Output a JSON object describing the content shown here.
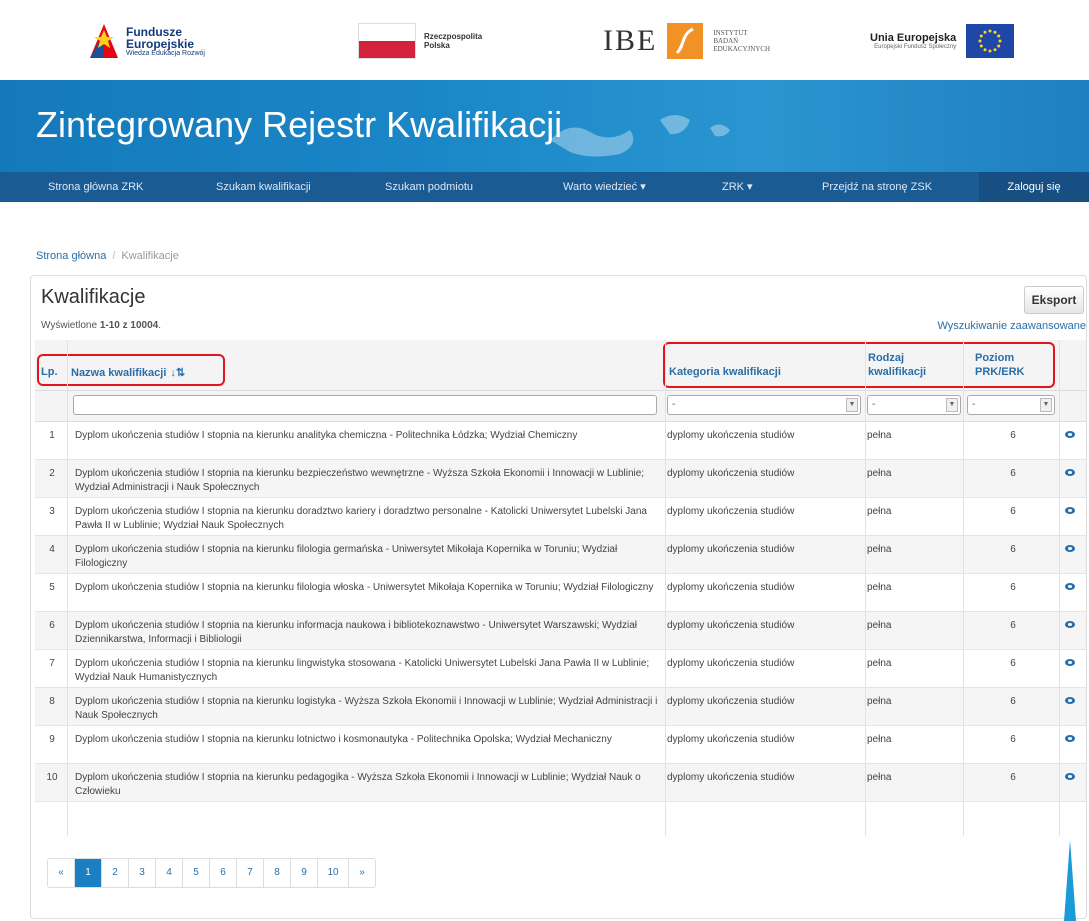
{
  "logos": {
    "fe": [
      "Fundusze",
      "Europejskie",
      "Wiedza Edukacja Rozwój"
    ],
    "rp": [
      "Rzeczpospolita",
      "Polska"
    ],
    "ibe": "IBE",
    "ibe_inst": [
      "INSTYTUT",
      "BADAŃ",
      "EDUKACYJNYCH"
    ],
    "ue": [
      "Unia Europejska",
      "Europejski Fundusz Społeczny"
    ]
  },
  "banner": {
    "title": "Zintegrowany Rejestr Kwalifikacji"
  },
  "nav": {
    "items": [
      "Strona główna ZRK",
      "Szukam kwalifikacji",
      "Szukam podmiotu",
      "Warto wiedzieć ▾",
      "ZRK ▾",
      "Przejdź na stronę ZSK"
    ],
    "login": "Zaloguj się"
  },
  "breadcrumb": {
    "home": "Strona główna",
    "separator": "/",
    "current": "Kwalifikacje"
  },
  "panel": {
    "title": "Kwalifikacje",
    "export": "Eksport",
    "count_prefix": "Wyświetlone ",
    "count_range": "1-10 z 10004",
    "count_suffix": ".",
    "advanced": "Wyszukiwanie zaawansowane"
  },
  "table": {
    "headers": {
      "lp": "Lp.",
      "name": "Nazwa kwalifikacji",
      "category": "Kategoria kwalifikacji",
      "type": [
        "Rodzaj",
        "kwalifikacji"
      ],
      "level": [
        "Poziom",
        "PRK/ERK"
      ]
    },
    "filters": {
      "category": "-",
      "type": "-",
      "level": "-"
    },
    "rows": [
      {
        "lp": "1",
        "name": "Dyplom ukończenia studiów I stopnia na kierunku analityka chemiczna - Politechnika Łódzka; Wydział Chemiczny",
        "category": "dyplomy ukończenia studiów",
        "type": "pełna",
        "level": "6"
      },
      {
        "lp": "2",
        "name": "Dyplom ukończenia studiów I stopnia na kierunku bezpieczeństwo wewnętrzne - Wyższa Szkoła Ekonomii i Innowacji w Lublinie; Wydział Administracji i Nauk Społecznych",
        "category": "dyplomy ukończenia studiów",
        "type": "pełna",
        "level": "6"
      },
      {
        "lp": "3",
        "name": "Dyplom ukończenia studiów I stopnia na kierunku doradztwo kariery i doradztwo personalne - Katolicki Uniwersytet Lubelski Jana Pawła II w Lublinie; Wydział Nauk Społecznych",
        "category": "dyplomy ukończenia studiów",
        "type": "pełna",
        "level": "6"
      },
      {
        "lp": "4",
        "name": "Dyplom ukończenia studiów I stopnia na kierunku filologia germańska - Uniwersytet Mikołaja Kopernika w Toruniu; Wydział Filologiczny",
        "category": "dyplomy ukończenia studiów",
        "type": "pełna",
        "level": "6"
      },
      {
        "lp": "5",
        "name": "Dyplom ukończenia studiów I stopnia na kierunku filologia włoska - Uniwersytet Mikołaja Kopernika w Toruniu; Wydział Filologiczny",
        "category": "dyplomy ukończenia studiów",
        "type": "pełna",
        "level": "6"
      },
      {
        "lp": "6",
        "name": "Dyplom ukończenia studiów I stopnia na kierunku informacja naukowa i bibliotekoznawstwo - Uniwersytet Warszawski; Wydział Dziennikarstwa, Informacji i Bibliologii",
        "category": "dyplomy ukończenia studiów",
        "type": "pełna",
        "level": "6"
      },
      {
        "lp": "7",
        "name": "Dyplom ukończenia studiów I stopnia na kierunku lingwistyka stosowana - Katolicki Uniwersytet Lubelski Jana Pawła II w Lublinie; Wydział Nauk Humanistycznych",
        "category": "dyplomy ukończenia studiów",
        "type": "pełna",
        "level": "6"
      },
      {
        "lp": "8",
        "name": "Dyplom ukończenia studiów I stopnia na kierunku logistyka - Wyższa Szkoła Ekonomii i Innowacji w Lublinie; Wydział Administracji i Nauk Społecznych",
        "category": "dyplomy ukończenia studiów",
        "type": "pełna",
        "level": "6"
      },
      {
        "lp": "9",
        "name": "Dyplom ukończenia studiów I stopnia na kierunku lotnictwo i kosmonautyka - Politechnika Opolska; Wydział Mechaniczny",
        "category": "dyplomy ukończenia studiów",
        "type": "pełna",
        "level": "6"
      },
      {
        "lp": "10",
        "name": "Dyplom ukończenia studiów I stopnia na kierunku pedagogika - Wyższa Szkoła Ekonomii i Innowacji w Lublinie; Wydział Nauk o Człowieku",
        "category": "dyplomy ukończenia studiów",
        "type": "pełna",
        "level": "6"
      }
    ]
  },
  "pagination": {
    "prev": "«",
    "pages": [
      "1",
      "2",
      "3",
      "4",
      "5",
      "6",
      "7",
      "8",
      "9",
      "10"
    ],
    "next": "»",
    "active": "1"
  },
  "colors": {
    "banner": "#1479ba",
    "nav": "#1b5b94",
    "link": "#2a6ea8",
    "highlight": "#e0161e",
    "arrow": "#1a9ad6"
  }
}
